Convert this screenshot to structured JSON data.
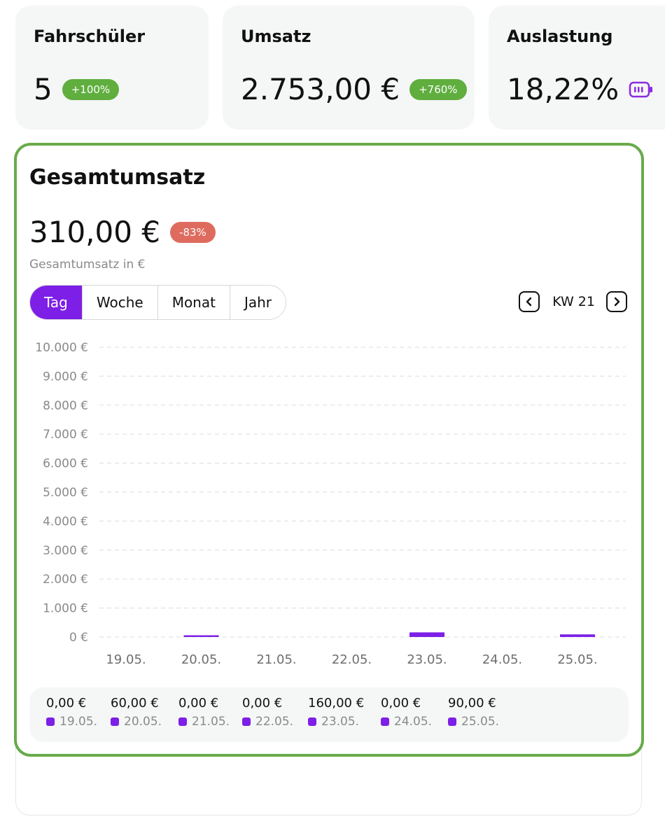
{
  "stats": [
    {
      "title": "Fahrschüler",
      "value": "5",
      "badge": "+100%"
    },
    {
      "title": "Umsatz",
      "value": "2.753,00 €",
      "badge": "+760%"
    },
    {
      "title": "Auslastung",
      "value": "18,22%",
      "icon": "battery-icon"
    }
  ],
  "main": {
    "title": "Gesamtumsatz",
    "value": "310,00 €",
    "badge": "-83%",
    "subtitle": "Gesamtumsatz in €",
    "tabs": [
      "Tag",
      "Woche",
      "Monat",
      "Jahr"
    ],
    "active_tab": "Tag",
    "week_label": "KW 21"
  },
  "colors": {
    "accent": "#7d1fe6",
    "positive": "#5fae3e",
    "negative": "#de6b5e",
    "border": "#67ab4a"
  },
  "chart_data": {
    "type": "bar",
    "categories": [
      "19.05.",
      "20.05.",
      "21.05.",
      "22.05.",
      "23.05.",
      "24.05.",
      "25.05."
    ],
    "values": [
      0,
      60,
      0,
      0,
      160,
      0,
      90
    ],
    "value_labels": [
      "0,00 €",
      "60,00 €",
      "0,00 €",
      "0,00 €",
      "160,00 €",
      "0,00 €",
      "90,00 €"
    ],
    "yticks": [
      "0 €",
      "1.000 €",
      "2.000 €",
      "3.000 €",
      "4.000 €",
      "5.000 €",
      "6.000 €",
      "7.000 €",
      "8.000 €",
      "9.000 €",
      "10.000 €"
    ],
    "ylim": [
      0,
      10000
    ],
    "grid": true,
    "legend": "bottom"
  }
}
